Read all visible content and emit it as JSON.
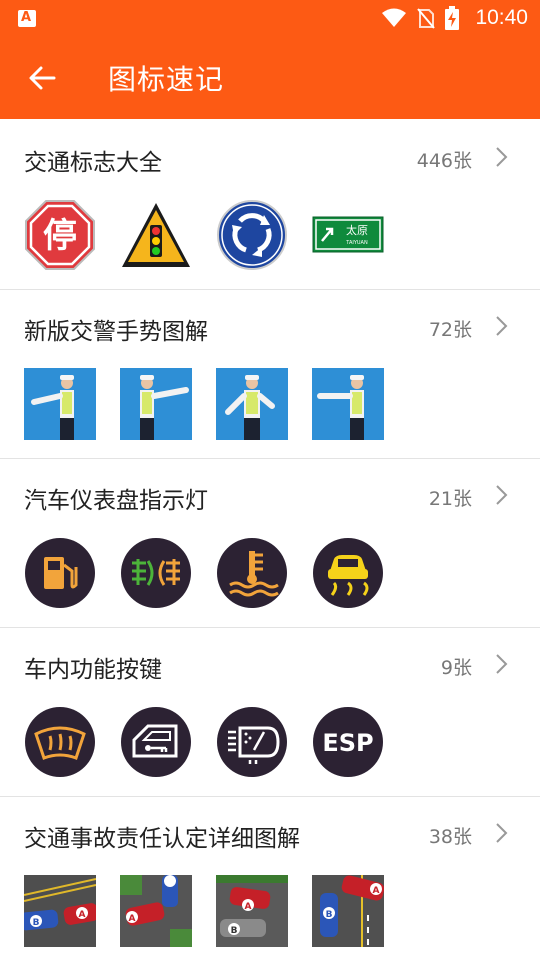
{
  "status": {
    "time": "10:40"
  },
  "header": {
    "title": "图标速记"
  },
  "sections": [
    {
      "title": "交通标志大全",
      "count": "446张",
      "sign_stop": "停",
      "sign_guide": "太原",
      "sign_guide_sub": "TAIYUAN"
    },
    {
      "title": "新版交警手势图解",
      "count": "72张"
    },
    {
      "title": "汽车仪表盘指示灯",
      "count": "21张"
    },
    {
      "title": "车内功能按键",
      "count": "9张",
      "esp_label": "ESP"
    },
    {
      "title": "交通事故责任认定详细图解",
      "count": "38张",
      "car_a": "A",
      "car_b": "B"
    }
  ],
  "colors": {
    "accent": "#fd5a14",
    "icon_bg": "#2c2233",
    "icon_fg": "#f2a43b",
    "esp_fg": "#ffffff"
  }
}
